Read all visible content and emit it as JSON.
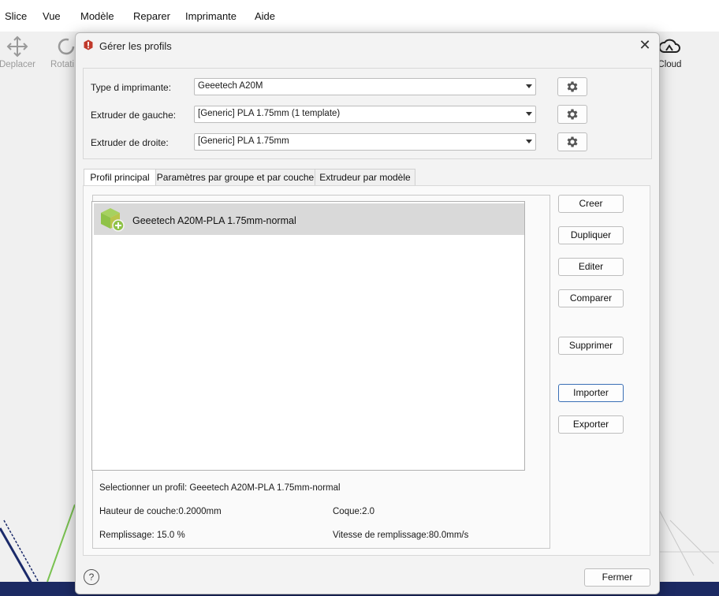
{
  "menubar": {
    "items": [
      "Slice",
      "Vue",
      "Modèle",
      "Reparer",
      "Imprimante",
      "Aide"
    ]
  },
  "toolbar": {
    "move_label": "Deplacer",
    "rotate_label": "Rotati",
    "cloud_label": "eCloud"
  },
  "dialog": {
    "title": "Gérer les profils",
    "close_glyph": "✕",
    "printer_type_label": "Type d imprimante:",
    "printer_type_value": "Geeetech A20M",
    "left_extruder_label": "Extruder de gauche:",
    "left_extruder_value": "[Generic] PLA 1.75mm (1 template)",
    "right_extruder_label": "Extruder de droite:",
    "right_extruder_value": "[Generic] PLA 1.75mm",
    "tabs": [
      "Profil principal",
      "Paramètres par groupe et par couche",
      "Extrudeur par modèle"
    ],
    "profiles": [
      "Geeetech A20M-PLA 1.75mm-normal"
    ],
    "buttons": {
      "create": "Creer",
      "duplicate": "Dupliquer",
      "edit": "Editer",
      "compare": "Comparer",
      "delete": "Supprimer",
      "import": "Importer",
      "export": "Exporter"
    },
    "selected_profile": "Selectionner un profil: Geeetech A20M-PLA 1.75mm-normal",
    "layer_height": "Hauteur de couche:0.2000mm",
    "shell": "Coque:2.0",
    "infill": "Remplissage: 15.0 %",
    "infill_speed": "Vitesse de remplissage:80.0mm/s",
    "help_glyph": "?",
    "close_button": "Fermer"
  },
  "colors": {
    "title_icon": "#c0392b",
    "cube": "#8fc248",
    "focus_border": "#3a6fb5"
  }
}
